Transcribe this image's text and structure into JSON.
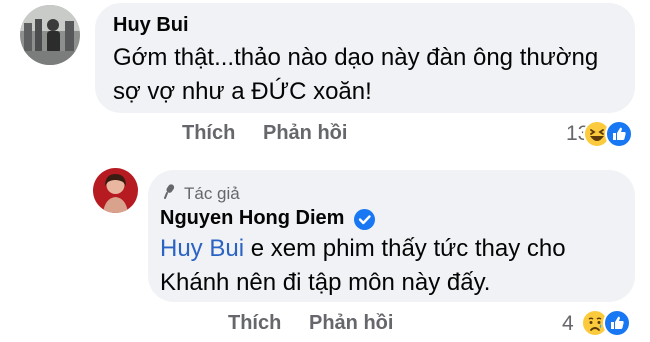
{
  "comments": [
    {
      "author": "Huy Bui",
      "text_line1": "Gớm thật...thảo nào dạo này đàn ông thường",
      "text_line2": "sợ vợ như a ĐỨC xoăn!",
      "actions": {
        "like": "Thích",
        "reply": "Phản hồi"
      },
      "reaction_count": "13",
      "reactions": [
        "haha-icon",
        "like-icon"
      ]
    },
    {
      "author": "Nguyen Hong Diem",
      "author_badge": "Tác giả",
      "verified": true,
      "mention": "Huy Bui",
      "text_line1_rest": " e xem phim thấy tức thay cho",
      "text_line2": "Khánh nên đi tập môn này đấy.",
      "actions": {
        "like": "Thích",
        "reply": "Phản hồi"
      },
      "reaction_count": "4",
      "reactions": [
        "sad-icon",
        "like-icon"
      ]
    }
  ],
  "colors": {
    "bubble": "#f0f2f5",
    "secondary_text": "#65676b",
    "mention": "#2a63c4",
    "verified": "#1877f2"
  }
}
